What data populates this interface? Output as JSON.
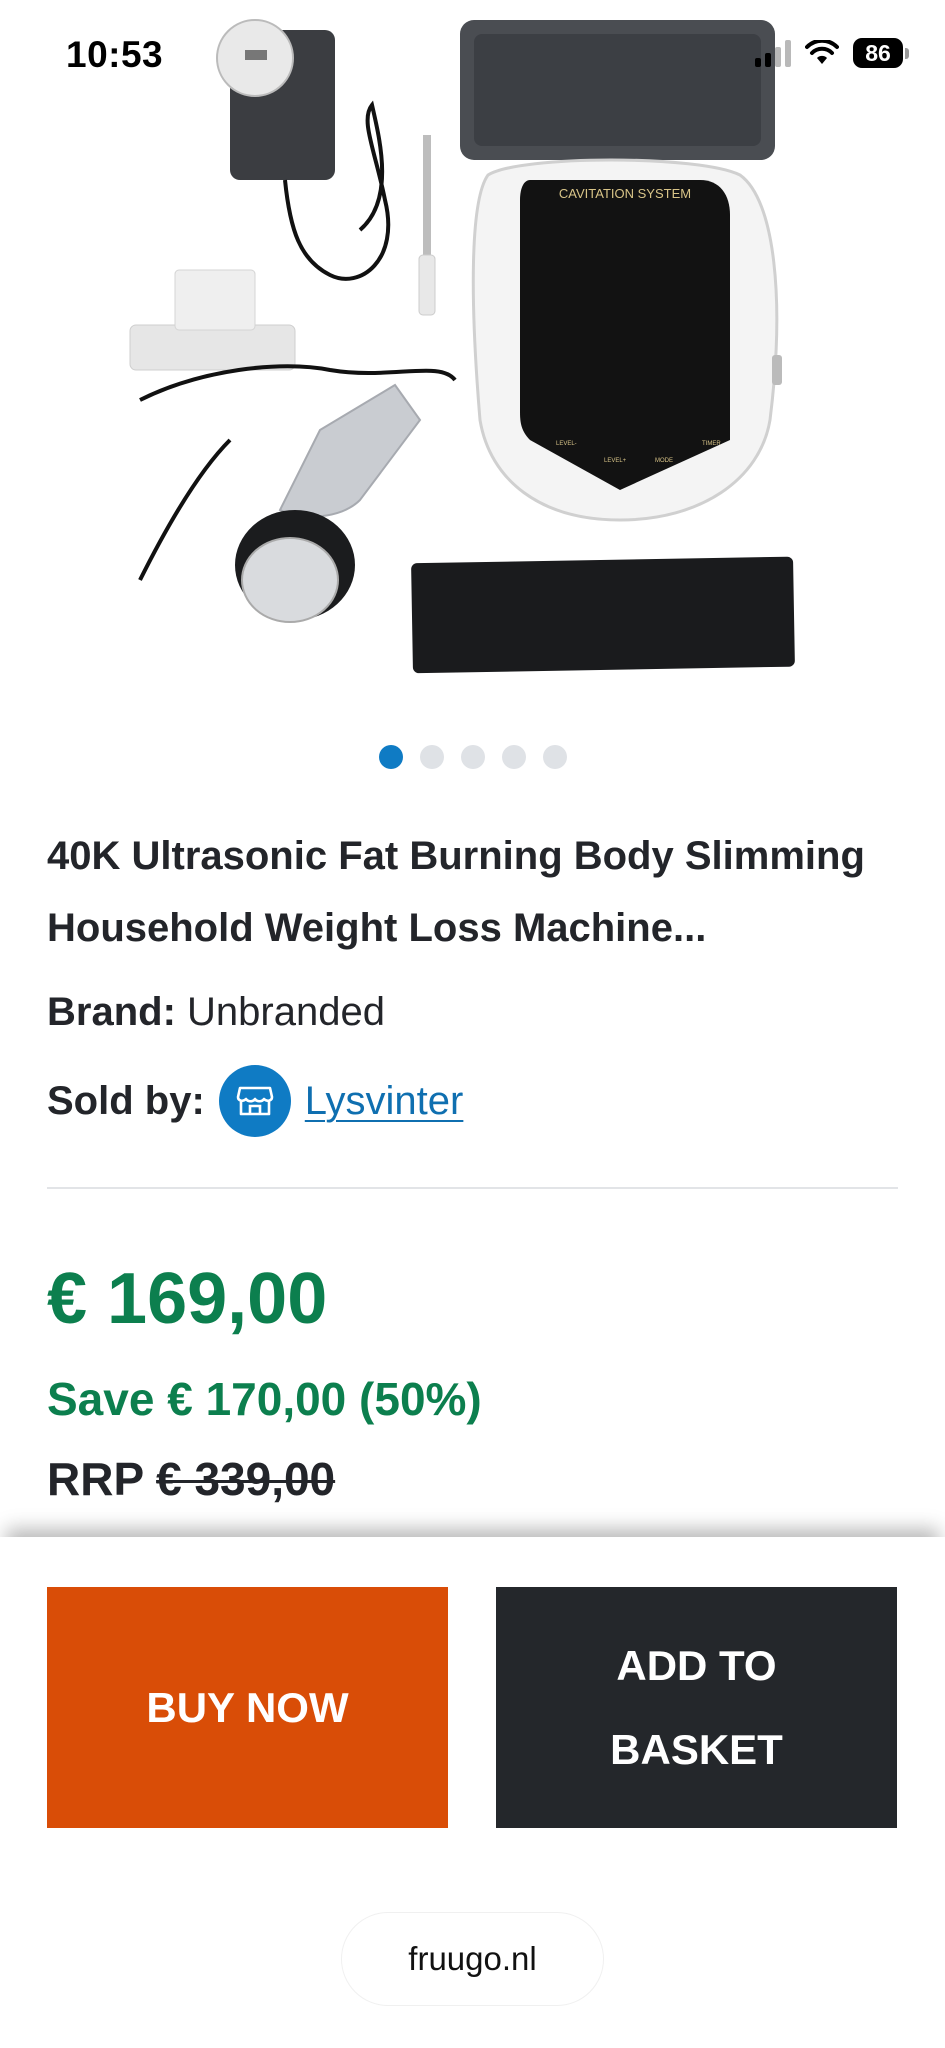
{
  "status_bar": {
    "time": "10:53",
    "battery": "86"
  },
  "gallery": {
    "device_label": "CAVITATION SYSTEM",
    "button_labels": [
      "LEVEL-",
      "LEVEL+",
      "MODE",
      "TIMER"
    ],
    "slide_count": 5,
    "active_slide": 1
  },
  "product": {
    "title": "40K Ultrasonic Fat Burning Body Slimming Household Weight Loss Machine...",
    "brand_label": "Brand:",
    "brand_value": "Unbranded",
    "sold_by_label": "Sold by:",
    "seller": "Lysvinter"
  },
  "pricing": {
    "price": "€ 169,00",
    "save": "Save € 170,00 (50%)",
    "rrp_label": "RRP",
    "rrp_value": "€ 339,00"
  },
  "actions": {
    "buy_now": "BUY NOW",
    "add_to_basket": "ADD TO BASKET"
  },
  "browser": {
    "url": "fruugo.nl"
  },
  "colors": {
    "price_green": "#0c7f4e",
    "link_blue": "#0f7bc4",
    "buy_orange": "#d94d07",
    "basket_dark": "#24272b"
  }
}
